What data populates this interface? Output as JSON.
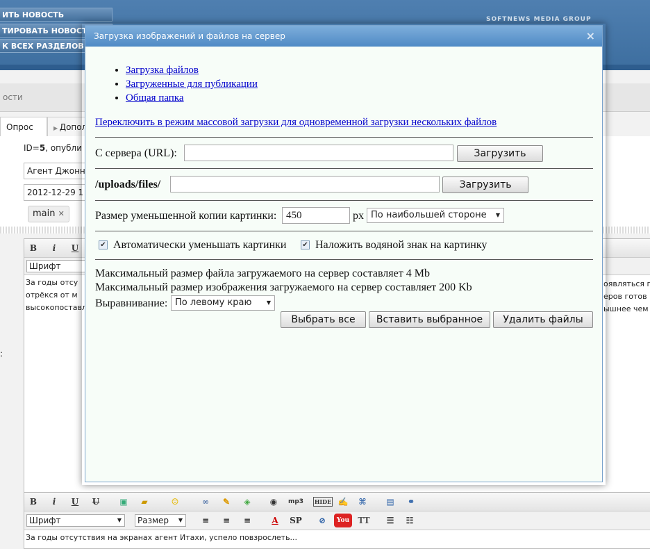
{
  "header": {
    "menu": [
      "ИТЬ НОВОСТЬ",
      "ТИРОВАТЬ НОВОСТИ",
      "К ВСЕХ РАЗДЕЛОВ"
    ],
    "brand": "SOFTNEWS MEDIA GROUP"
  },
  "subnav": {
    "label": "ости"
  },
  "tabs": [
    "Опрос",
    "Допол"
  ],
  "form": {
    "id_prefix": "ID=",
    "id_value": "5",
    "id_suffix": ", опубли",
    "author": "Агент Джонн",
    "date": "2012-12-29 1",
    "tag": "main",
    "tag_remove": "✕",
    "colon": ":"
  },
  "editor": {
    "font_label": "Шрифт",
    "size_label": "Размер",
    "text_lines": [
      "За годы отсу",
      "отрёкся от м",
      "высокопоставл"
    ],
    "right_lines": [
      "оявляться п",
      "еров готов",
      "ышнее чем"
    ],
    "bottom_text": "За годы отсутствия на экранах агент Итахи, успело повзрослеть..."
  },
  "modal": {
    "title": "Загрузка изображений и файлов на сервер",
    "close": "×",
    "links": [
      "Загрузка файлов",
      "Загруженные для публикации",
      "Общая папка"
    ],
    "mass_upload_link": "Переключить в режим массовой загрузки для одновременной загрузки нескольких файлов",
    "url_label": "С сервера (URL):",
    "url_value": "",
    "upload_button": "Загрузить",
    "path_label": "/uploads/files/",
    "path_value": "",
    "thumb_label": "Размер уменьшенной копии картинки:",
    "thumb_value": "450",
    "px_label": "px",
    "thumb_mode": "По наибольшей стороне",
    "auto_resize_label": "Автоматически уменьшать картинки",
    "watermark_label": "Наложить водяной знак на картинку",
    "max_file_text": "Максимальный размер файла загружаемого на сервер составляет 4 Mb",
    "max_image_text": "Максимальный размер изображения загружаемого на сервер составляет 200 Kb",
    "align_label": "Выравнивание:",
    "align_value": "По левому краю",
    "select_all_button": "Выбрать все",
    "insert_selected_button": "Вставить выбранное",
    "delete_files_button": "Удалить файлы"
  }
}
